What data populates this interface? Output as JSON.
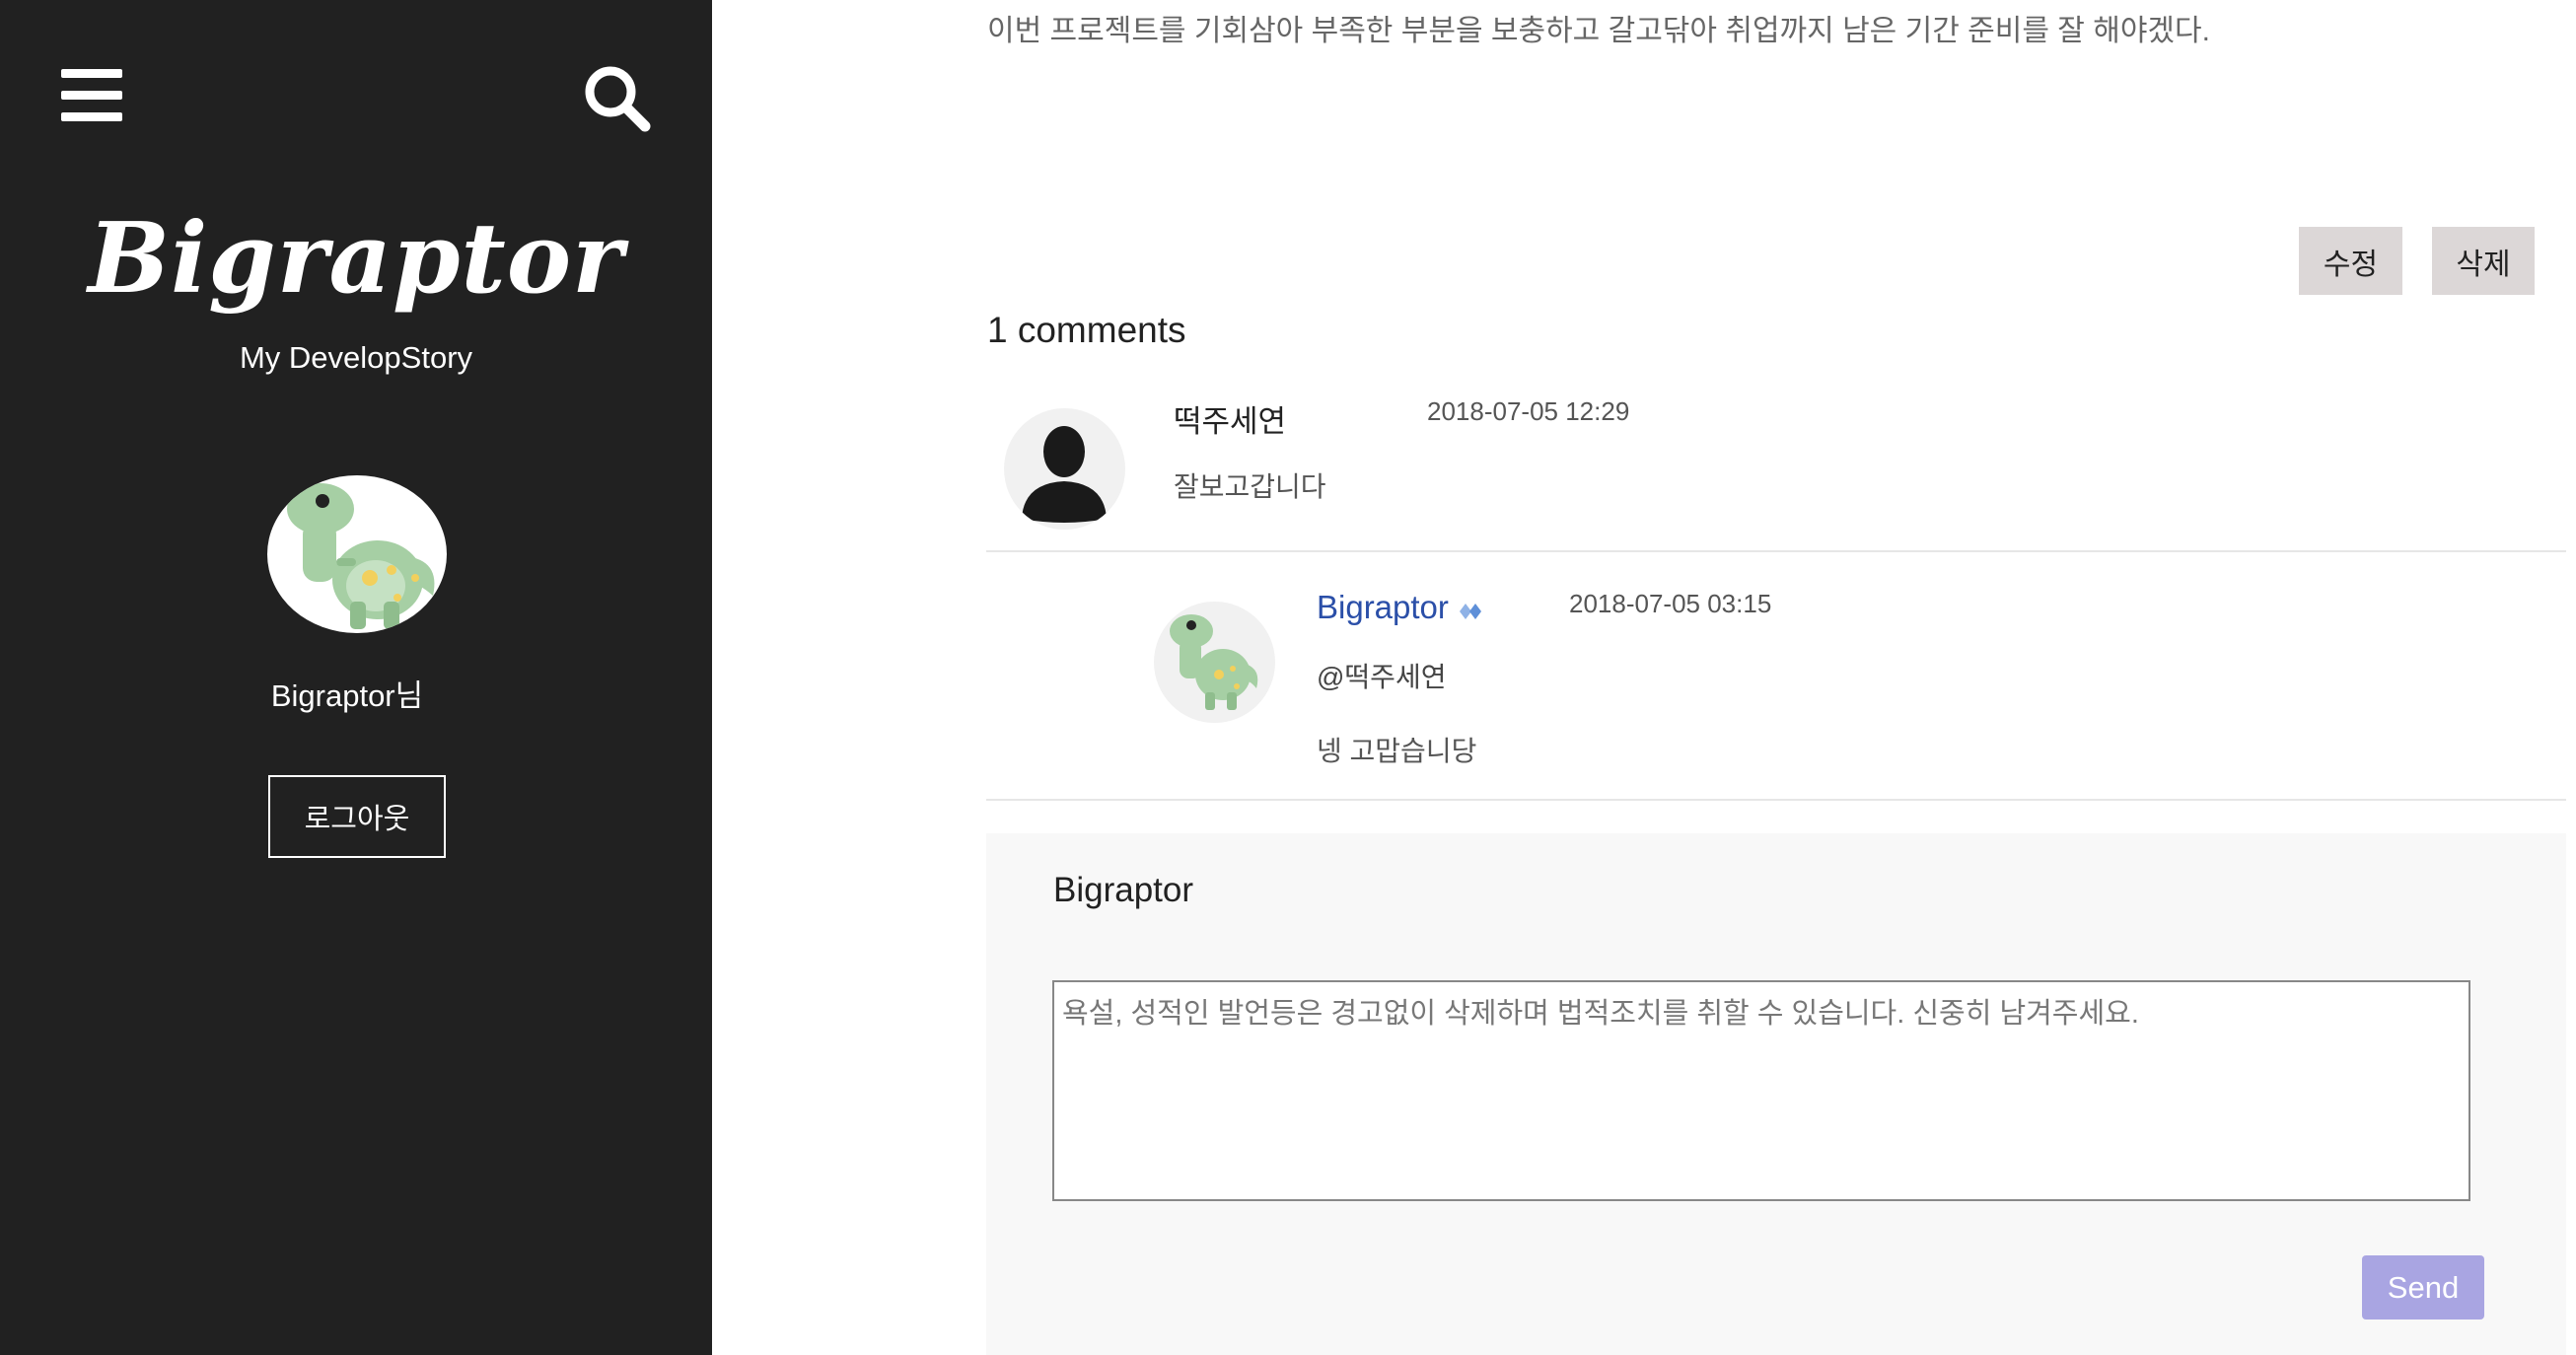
{
  "sidebar": {
    "menu_icon": "hamburger-menu-icon",
    "search_icon": "search-icon",
    "blog_title": "Bigraptor",
    "blog_subtitle": "My DevelopStory",
    "profile_name": "Bigraptor님",
    "logout_label": "로그아웃"
  },
  "post": {
    "text": "이번 프로젝트를 기회삼아 부족한 부분을 보충하고 갈고닦아 취업까지 남은 기간 준비를 잘 해야겠다.",
    "edit_label": "수정",
    "delete_label": "삭제"
  },
  "comments": {
    "count_label": "1 comments",
    "items": [
      {
        "author": "떡주세연",
        "date": "2018-07-05 12:29",
        "text": "잘보고갑니다"
      },
      {
        "author": "Bigraptor",
        "date": "2018-07-05 03:15",
        "mention": "@떡주세연",
        "text": "넹 고맙습니당"
      }
    ]
  },
  "comment_form": {
    "user": "Bigraptor",
    "placeholder": "욕설, 성적인 발언등은 경고없이 삭제하며 법적조치를 취할 수 있습니다. 신중히 남겨주세요.",
    "send_label": "Send"
  },
  "colors": {
    "sidebar_bg": "#212121",
    "accent_link": "#2b4fa8",
    "send_button": "#a9a5e2",
    "action_button": "#dcd7d7"
  }
}
